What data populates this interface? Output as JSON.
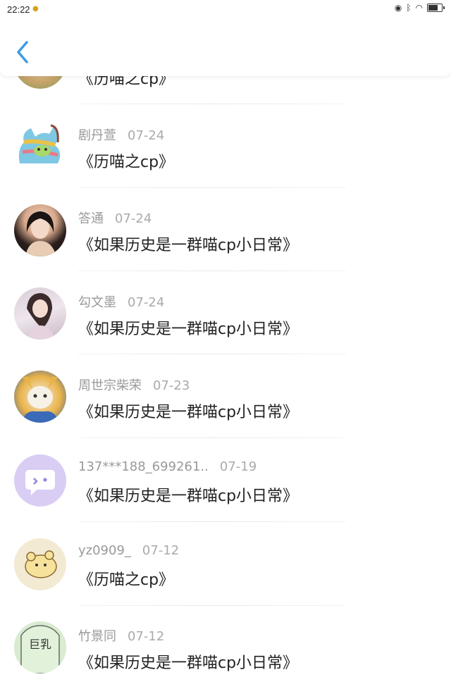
{
  "status_bar": {
    "time": "22:22"
  },
  "items": [
    {
      "name": "",
      "date": "",
      "title": "《历喵之cp》"
    },
    {
      "name": "剧丹萱",
      "date": "07-24",
      "title": "《历喵之cp》"
    },
    {
      "name": "答通",
      "date": "07-24",
      "title": "《如果历史是一群喵cp小日常》"
    },
    {
      "name": "勾文墨",
      "date": "07-24",
      "title": "《如果历史是一群喵cp小日常》"
    },
    {
      "name": "周世宗柴荣",
      "date": "07-23",
      "title": "《如果历史是一群喵cp小日常》"
    },
    {
      "name": "137***188_699261..",
      "date": "07-19",
      "title": "《如果历史是一群喵cp小日常》"
    },
    {
      "name": "yz0909_",
      "date": "07-12",
      "title": "《历喵之cp》"
    },
    {
      "name": "竹景同",
      "date": "07-12",
      "title": "《如果历史是一群喵cp小日常》"
    }
  ],
  "avatar_7_text": "巨乳",
  "colors": {
    "accent": "#3d9bea"
  }
}
